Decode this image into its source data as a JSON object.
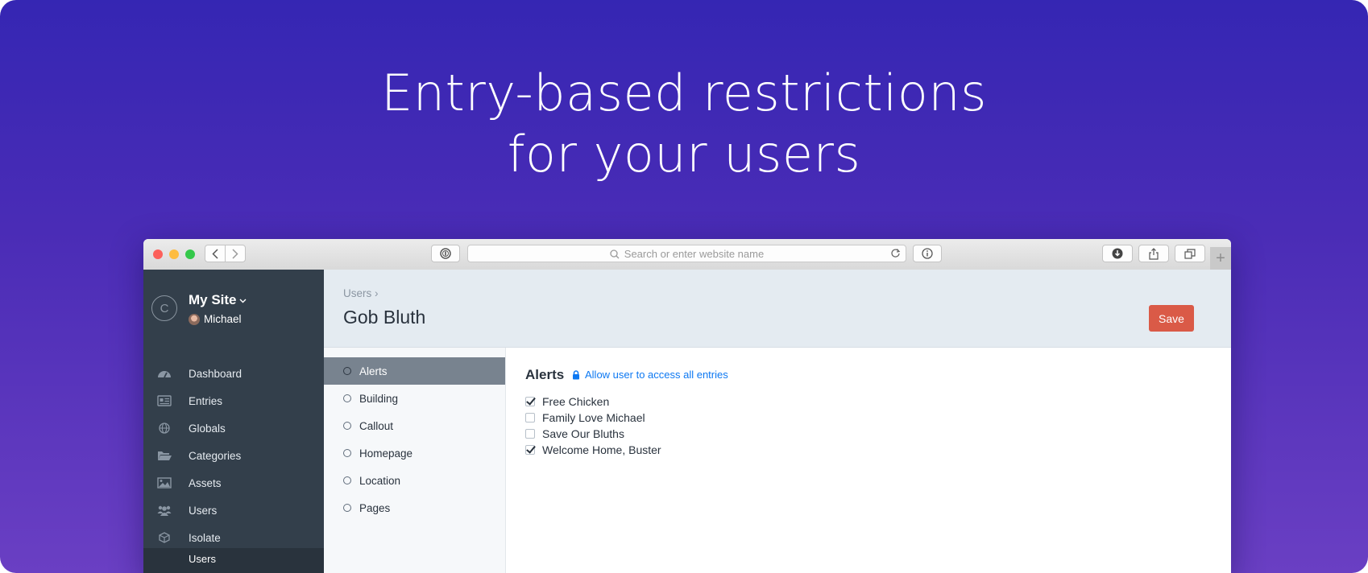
{
  "headline": {
    "line1": "Entry-based restrictions",
    "line2": "for your users"
  },
  "browser": {
    "url_placeholder": "Search or enter website name",
    "traffic_lights": [
      "#fc605b",
      "#fdbc40",
      "#34c84a"
    ]
  },
  "sidebar": {
    "logo_letter": "C",
    "site_name": "My Site",
    "user_name": "Michael",
    "items": [
      {
        "label": "Dashboard",
        "icon": "dashboard-icon"
      },
      {
        "label": "Entries",
        "icon": "entries-icon"
      },
      {
        "label": "Globals",
        "icon": "globe-icon"
      },
      {
        "label": "Categories",
        "icon": "folder-icon"
      },
      {
        "label": "Assets",
        "icon": "image-icon"
      },
      {
        "label": "Users",
        "icon": "users-icon"
      },
      {
        "label": "Isolate",
        "icon": "cube-icon"
      }
    ],
    "subitem": "Users"
  },
  "header": {
    "breadcrumb": "Users",
    "title": "Gob Bluth",
    "save_label": "Save"
  },
  "sections": [
    "Alerts",
    "Building",
    "Callout",
    "Homepage",
    "Location",
    "Pages"
  ],
  "content": {
    "title": "Alerts",
    "allow_link": "Allow user to access all entries",
    "entries": [
      {
        "label": "Free Chicken",
        "checked": true
      },
      {
        "label": "Family Love Michael",
        "checked": false
      },
      {
        "label": "Save Our Bluths",
        "checked": false
      },
      {
        "label": "Welcome Home, Buster",
        "checked": true
      }
    ]
  },
  "colors": {
    "save_button": "#da5a47",
    "link": "#0d78f2",
    "sidebar_bg": "#333f4b"
  }
}
